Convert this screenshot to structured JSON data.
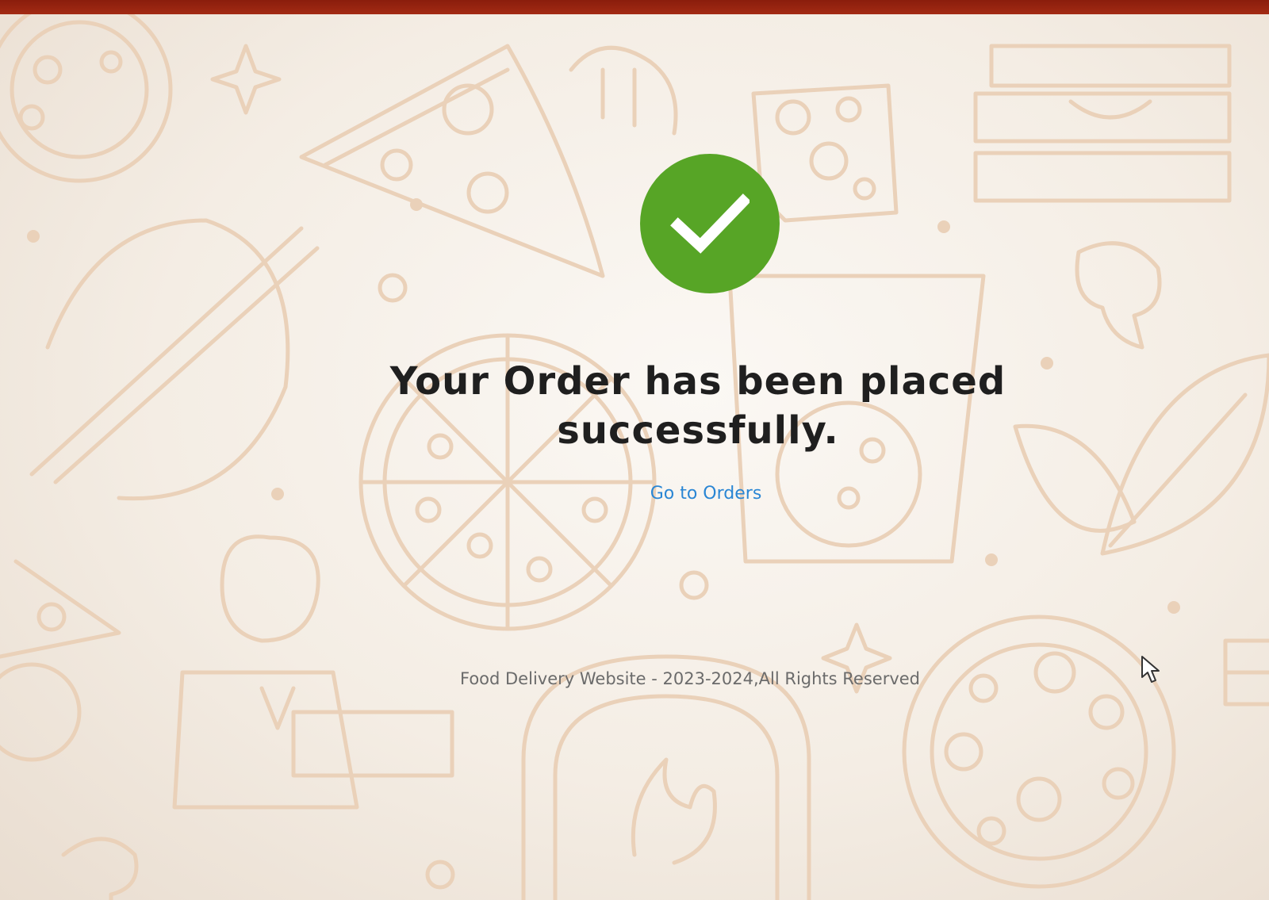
{
  "window": {
    "background_color": "#f6efe6",
    "top_band_color": "#b8361a"
  },
  "status": {
    "icon": "check-circle-icon",
    "icon_color": "#57a526"
  },
  "message": {
    "heading": "Your Order has been placed successfully."
  },
  "actions": {
    "go_to_orders_label": "Go to Orders",
    "link_color": "#2a86d4"
  },
  "footer": {
    "text": "Food Delivery Website - 2023-2024,All Rights Reserved"
  },
  "background_pattern": {
    "icons": [
      "pizza-slice-icon",
      "pizza-icon",
      "cheese-icon",
      "rolling-pin-icon",
      "mushroom-icon",
      "leaf-icon",
      "pizza-box-icon",
      "oven-icon",
      "chef-icon",
      "star-icon"
    ]
  }
}
